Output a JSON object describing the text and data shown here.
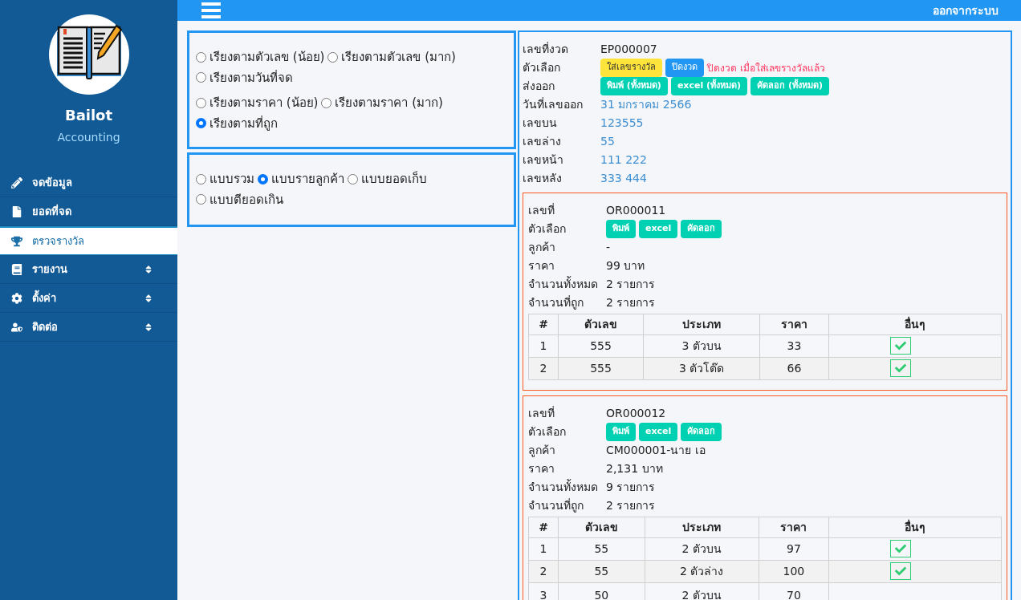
{
  "sidebar": {
    "brand": "Bailot",
    "subtitle": "Accounting",
    "items": [
      {
        "label": "จดข้อมูล",
        "selected": false,
        "expandable": false
      },
      {
        "label": "ยอดที่จด",
        "selected": false,
        "expandable": false
      },
      {
        "label": "ตรวจรางวัล",
        "selected": true,
        "expandable": false
      },
      {
        "label": "รายงาน",
        "selected": false,
        "expandable": true
      },
      {
        "label": "ตั้งค่า",
        "selected": false,
        "expandable": true
      },
      {
        "label": "ติดต่อ",
        "selected": false,
        "expandable": true
      }
    ]
  },
  "topbar": {
    "logout": "ออกจากระบบ"
  },
  "sort_options": [
    {
      "label": "เรียงตามตัวเลข (น้อย)",
      "selected": false
    },
    {
      "label": "เรียงตามตัวเลข (มาก)",
      "selected": false
    },
    {
      "label": "เรียงตามวันที่จด",
      "selected": false
    },
    {
      "label": "เรียงตามราคา (น้อย)",
      "selected": false
    },
    {
      "label": "เรียงตามราคา (มาก)",
      "selected": false
    },
    {
      "label": "เรียงตามที่ถูก",
      "selected": true
    }
  ],
  "view_options": [
    {
      "label": "แบบรวม",
      "selected": false
    },
    {
      "label": "แบบรายลูกค้า",
      "selected": true
    },
    {
      "label": "แบบยอดเก็บ",
      "selected": false
    },
    {
      "label": "แบบตียอดเกิน",
      "selected": false
    }
  ],
  "period": {
    "id_label": "เลขที่งวด",
    "id": "EP000007",
    "options_label": "ตัวเลือก",
    "option_buttons": [
      {
        "label": "ใส่เลขรางวัล",
        "kind": "warning"
      },
      {
        "label": "ปิดงวด",
        "kind": "primary"
      }
    ],
    "note": "ปิดงวด เมื่อใส่เลขรางวัลแล้ว",
    "export_label": "ส่งออก",
    "export_buttons": [
      "พิมพ์ (ทั้งหมด)",
      "excel (ทั้งหมด)",
      "คัดลอก (ทั้งหมด)"
    ],
    "fields": [
      {
        "label": "วันที่เลขออก",
        "value": "31 มกราคม 2566"
      },
      {
        "label": "เลขบน",
        "value": "123555"
      },
      {
        "label": "เลขล่าง",
        "value": "55"
      },
      {
        "label": "เลขหน้า",
        "value": "111 222"
      },
      {
        "label": "เลขหลัง",
        "value": "333 444"
      }
    ]
  },
  "orders": [
    {
      "fields": [
        {
          "label": "เลขที่",
          "value": "OR000011"
        },
        {
          "label": "ตัวเลือก",
          "buttons": [
            "พิมพ์",
            "excel",
            "คัดลอก"
          ]
        },
        {
          "label": "ลูกค้า",
          "value": "-"
        },
        {
          "label": "ราคา",
          "value": "99 บาท"
        },
        {
          "label": "จำนวนทั้งหมด",
          "value": "2 รายการ"
        },
        {
          "label": "จำนวนที่ถูก",
          "value": "2 รายการ"
        }
      ],
      "columns": [
        "#",
        "ตัวเลข",
        "ประเภท",
        "ราคา",
        "อื่นๆ"
      ],
      "rows": [
        {
          "cells": [
            "1",
            "555",
            "3 ตัวบน",
            "33"
          ],
          "matched": true
        },
        {
          "cells": [
            "2",
            "555",
            "3 ตัวโต๊ด",
            "66"
          ],
          "matched": true
        }
      ]
    },
    {
      "fields": [
        {
          "label": "เลขที่",
          "value": "OR000012"
        },
        {
          "label": "ตัวเลือก",
          "buttons": [
            "พิมพ์",
            "excel",
            "คัดลอก"
          ]
        },
        {
          "label": "ลูกค้า",
          "value": "CM000001-นาย เอ"
        },
        {
          "label": "ราคา",
          "value": "2,131 บาท"
        },
        {
          "label": "จำนวนทั้งหมด",
          "value": "9 รายการ"
        },
        {
          "label": "จำนวนที่ถูก",
          "value": "2 รายการ"
        }
      ],
      "columns": [
        "#",
        "ตัวเลข",
        "ประเภท",
        "ราคา",
        "อื่นๆ"
      ],
      "rows": [
        {
          "cells": [
            "1",
            "55",
            "2 ตัวบน",
            "97"
          ],
          "matched": true
        },
        {
          "cells": [
            "2",
            "55",
            "2 ตัวล่าง",
            "100"
          ],
          "matched": true
        },
        {
          "cells": [
            "3",
            "50",
            "2 ตัวบน",
            "70"
          ],
          "matched": false
        }
      ]
    }
  ]
}
